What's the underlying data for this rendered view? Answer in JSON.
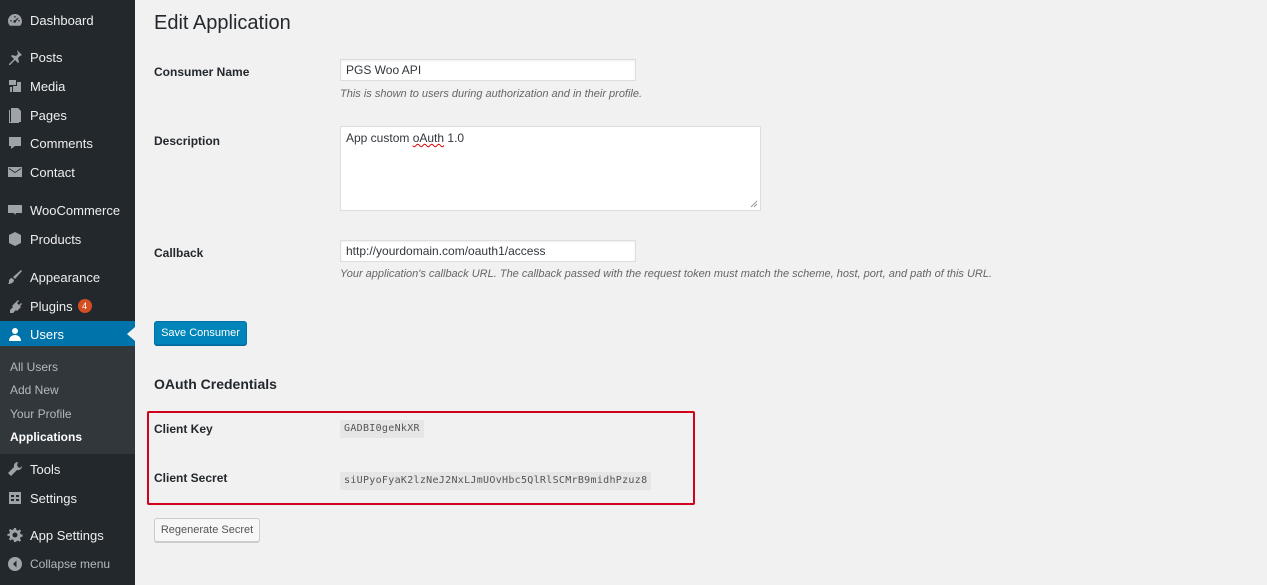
{
  "sidebar": {
    "items": [
      {
        "label": "Dashboard",
        "icon": "dashboard-icon"
      },
      {
        "label": "Posts",
        "icon": "pin-icon"
      },
      {
        "label": "Media",
        "icon": "media-icon"
      },
      {
        "label": "Pages",
        "icon": "page-icon"
      },
      {
        "label": "Comments",
        "icon": "comment-icon"
      },
      {
        "label": "Contact",
        "icon": "mail-icon"
      },
      {
        "label": "WooCommerce",
        "icon": "woocommerce-icon"
      },
      {
        "label": "Products",
        "icon": "archive-icon"
      },
      {
        "label": "Appearance",
        "icon": "brush-icon"
      },
      {
        "label": "Plugins",
        "icon": "plugin-icon",
        "badge": "4"
      },
      {
        "label": "Users",
        "icon": "user-icon"
      },
      {
        "label": "Tools",
        "icon": "wrench-icon"
      },
      {
        "label": "Settings",
        "icon": "settings-icon"
      },
      {
        "label": "App Settings",
        "icon": "gear-icon"
      },
      {
        "label": "Collapse menu",
        "icon": "collapse-icon"
      }
    ],
    "submenu": [
      "All Users",
      "Add New",
      "Your Profile",
      "Applications"
    ],
    "active": "Users",
    "current_sub": "Applications"
  },
  "page": {
    "title": "Edit Application",
    "consumer_name_label": "Consumer Name",
    "consumer_name_value": "PGS Woo API",
    "consumer_name_help": "This is shown to users during authorization and in their profile.",
    "description_label": "Description",
    "description_value_prefix": "App custom ",
    "description_value_underlined": "oAuth",
    "description_value_suffix": " 1.0",
    "callback_label": "Callback",
    "callback_value": "http://yourdomain.com/oauth1/access",
    "callback_help": "Your application's callback URL. The callback passed with the request token must match the scheme, host, port, and path of this URL.",
    "save_button": "Save Consumer",
    "credentials_title": "OAuth Credentials",
    "client_key_label": "Client Key",
    "client_key_value": "GADBI0geNkXR",
    "client_secret_label": "Client Secret",
    "client_secret_value": "siUPyoFyaK2lzNeJ2NxLJmUOvHbc5QlRlSCMrB9midhPzuz8",
    "regenerate_button": "Regenerate Secret"
  },
  "colors": {
    "sidebar_bg": "#23282d",
    "active_bg": "#0073aa",
    "primary_button": "#0085ba",
    "highlight_border": "#d0021b"
  }
}
